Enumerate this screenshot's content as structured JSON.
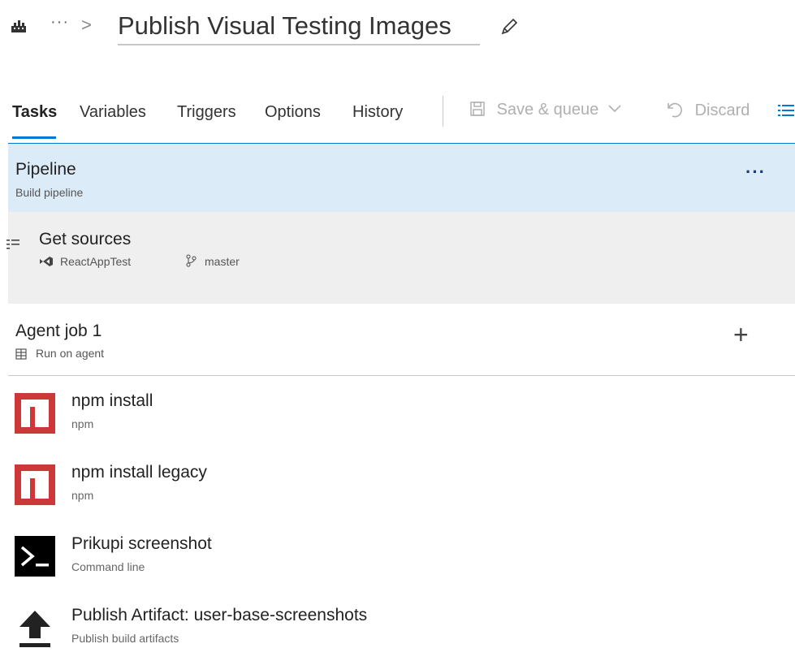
{
  "header": {
    "ellipsis": "···",
    "chevron": ">",
    "title": "Publish Visual Testing Images",
    "icons": {
      "build": "build-pipeline-icon",
      "edit": "pencil-icon"
    }
  },
  "tabs": [
    {
      "label": "Tasks",
      "active": true
    },
    {
      "label": "Variables"
    },
    {
      "label": "Triggers"
    },
    {
      "label": "Options"
    },
    {
      "label": "History"
    }
  ],
  "toolbar": {
    "save_queue_label": "Save & queue",
    "discard_label": "Discard"
  },
  "pipeline": {
    "title": "Pipeline",
    "subtitle": "Build pipeline",
    "more": "···"
  },
  "sources": {
    "title": "Get sources",
    "repo": "ReactAppTest",
    "branch": "master"
  },
  "agent_job": {
    "title": "Agent job 1",
    "subtitle": "Run on agent",
    "add": "+"
  },
  "tasks": [
    {
      "title": "npm install",
      "subtitle": "npm",
      "icon": "npm-icon"
    },
    {
      "title": "npm install legacy",
      "subtitle": "npm",
      "icon": "npm-icon"
    },
    {
      "title": "Prikupi screenshot",
      "subtitle": "Command line",
      "icon": "terminal-icon"
    },
    {
      "title": "Publish Artifact: user-base-screenshots",
      "subtitle": "Publish build artifacts",
      "icon": "upload-icon"
    }
  ],
  "colors": {
    "accent": "#0078d4",
    "selected_bg": "#dcebf8",
    "sources_bg": "#efefef",
    "npm_red": "#cb3837"
  }
}
